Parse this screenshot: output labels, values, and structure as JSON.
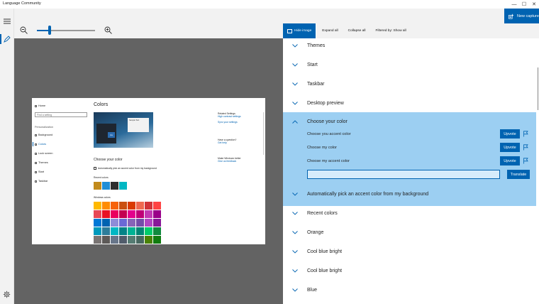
{
  "app": {
    "title": "Language Community"
  },
  "window_controls": {
    "minimize": "—",
    "maximize": "☐",
    "close": "✕"
  },
  "capture": {
    "label": "New capture"
  },
  "zoom": {
    "level_fraction": 0.2
  },
  "toolbar": {
    "hide_image": "Hide image",
    "expand_all": "Expand all",
    "collapse_all": "Collapse all",
    "filtered": "Filtered by: Show all"
  },
  "capture_image": {
    "home": "Home",
    "search_placeholder": "Find a setting",
    "section": "Personalization",
    "nav": [
      "Background",
      "Colors",
      "Lock screen",
      "Themes",
      "Start",
      "Taskbar"
    ],
    "title": "Colors",
    "preview_tile": "Aa",
    "preview_win": "Sample Text",
    "choose_color": "Choose your color",
    "auto_pick": "Automatically pick an accent color from my background",
    "recent_colors": "Recent colors",
    "windows_colors": "Windows colors",
    "related": "Related Settings",
    "high_contrast": "High contrast settings",
    "sync": "Sync your settings",
    "question": "Have a question?",
    "get_help": "Get help",
    "better": "Make Windows better",
    "feedback": "Give us feedback",
    "recent_swatches": [
      "#c28b1c",
      "#1f8ed6",
      "#2e2e2e",
      "#00b7c3"
    ],
    "grid_swatches": [
      "#ffb900",
      "#ff8c00",
      "#f7630c",
      "#ca5010",
      "#da3b01",
      "#ef6950",
      "#d13438",
      "#ff4343",
      "#e74856",
      "#e81123",
      "#ea005e",
      "#c30052",
      "#e3008c",
      "#bf0077",
      "#c239b3",
      "#9a0089",
      "#0078d7",
      "#0063b1",
      "#8e8cd8",
      "#6b69d6",
      "#8764b8",
      "#744da9",
      "#b146c2",
      "#881798",
      "#0099bc",
      "#2d7d9a",
      "#00b7c3",
      "#038387",
      "#00b294",
      "#018574",
      "#00cc6a",
      "#10893e",
      "#7a7574",
      "#5d5a58",
      "#68768a",
      "#515c6b",
      "#567c73",
      "#486860",
      "#498205",
      "#107c10"
    ]
  },
  "rows_top": [
    "Themes",
    "Start",
    "Taskbar",
    "Desktop preview"
  ],
  "expanded": {
    "title": "Choose your color",
    "strings": [
      "Choose you accent color",
      "Choose my color",
      "Choose my accent color"
    ],
    "upvote": "Upvote",
    "input_value": "",
    "translate": "Translate"
  },
  "rows_bottom": [
    "Automatically pick an accent color from my background",
    "Recent colors",
    "Orange",
    "Cool blue bright",
    "Cool blue bright",
    "Blue"
  ],
  "colors": {
    "accent": "#0063b1",
    "highlight": "#9ccff2",
    "canvas": "#636363"
  }
}
